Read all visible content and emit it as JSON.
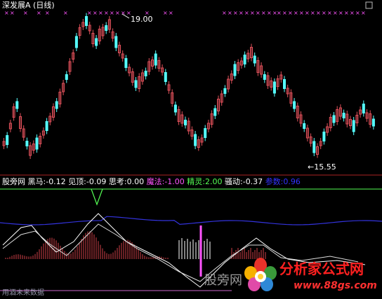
{
  "header": {
    "stock_name": "深发展A",
    "period": "(日线)"
  },
  "price_panel": {
    "high_label": "19.00",
    "low_label": "15.55",
    "arrow_glyph": "←"
  },
  "indicator_bar": {
    "name": "股旁网",
    "items": [
      {
        "label": "黑马:",
        "value": "-0.12",
        "color": "#ffffff"
      },
      {
        "label": "见顶:",
        "value": "-0.09",
        "color": "#ffffff"
      },
      {
        "label": "思考:",
        "value": "0.00",
        "color": "#ffffff"
      },
      {
        "label": "魔法:",
        "value": "-1.00",
        "color": "#ff55ff"
      },
      {
        "label": "精灵:",
        "value": "2.00",
        "color": "#55ff55"
      },
      {
        "label": "骚动:",
        "value": "-0.37",
        "color": "#ffffff"
      },
      {
        "label": "参数:",
        "value": "0.96",
        "color": "#3333ff"
      }
    ]
  },
  "footer": {
    "left_text": "用酒未来数据",
    "watermark": "股旁网"
  },
  "brand": {
    "name": "分析家公式网",
    "url": "www.88gs.com"
  },
  "colors": {
    "up": "#e0505a",
    "down": "#55ffff",
    "marker": "#ff55ff",
    "blue_line": "#3333dd",
    "green_line": "#55ff55",
    "brand_red": "#ff2020"
  },
  "icons": {
    "zoom": "square-icon",
    "marker": "x-marker-icon"
  }
}
